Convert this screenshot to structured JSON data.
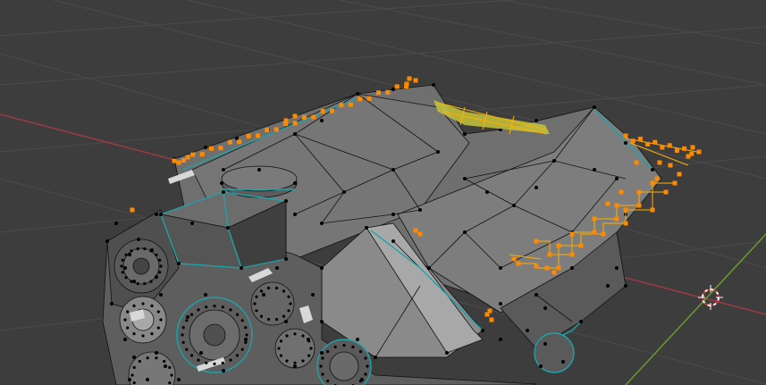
{
  "app": {
    "name": "3D Viewport"
  },
  "viewport": {
    "mode": "edit-mesh",
    "colors": {
      "background": "#3d3d3d",
      "grid": "#4a4a4a",
      "axis_x": "#9b3a45",
      "axis_y": "#6a9a2a",
      "mesh_face": "#6e6e6e",
      "mesh_face_dark": "#4a4a4a",
      "mesh_face_light": "#9a9a9a",
      "wire": "#111111",
      "vertex": "#000000",
      "seam": "#1e9aa0",
      "selected": "#ff8a00",
      "selected_edge": "#d6c13a",
      "cursor": "#ffffff"
    },
    "icons": [
      "3d-cursor-icon"
    ]
  }
}
